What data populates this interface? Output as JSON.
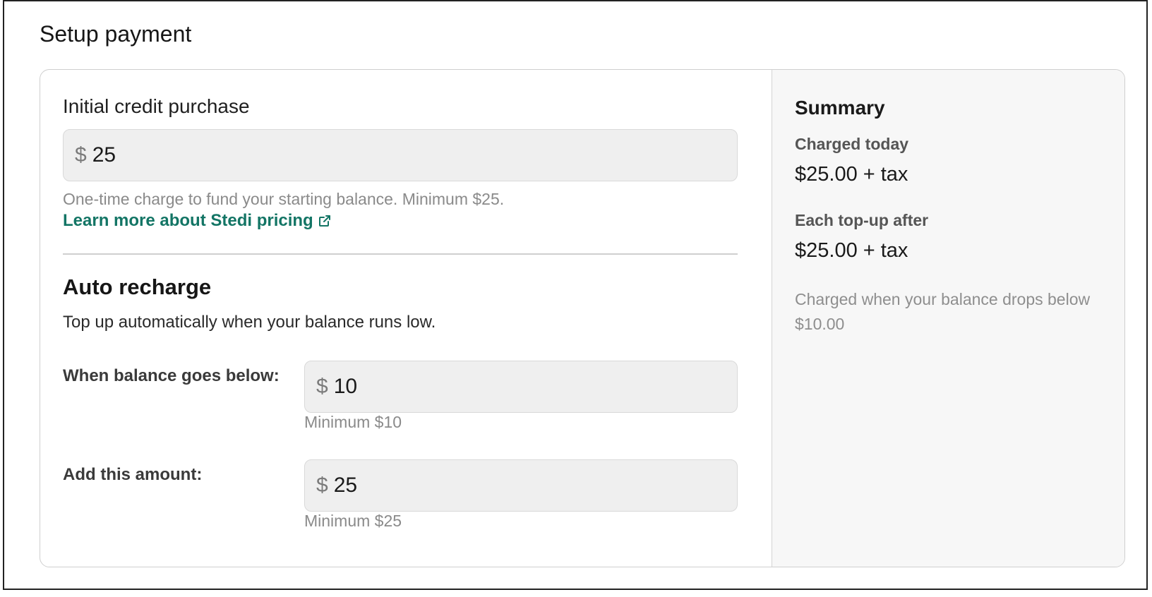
{
  "page": {
    "title": "Setup payment"
  },
  "initial_purchase": {
    "label": "Initial credit purchase",
    "currency_symbol": "$",
    "value": "25",
    "help": "One-time charge to fund your starting balance. Minimum $25.",
    "link_label": "Learn more about Stedi pricing",
    "link_icon": "external-link-icon"
  },
  "auto_recharge": {
    "title": "Auto recharge",
    "description": "Top up automatically when your balance runs low.",
    "threshold": {
      "label": "When balance goes below:",
      "currency_symbol": "$",
      "value": "10",
      "help": "Minimum $10"
    },
    "amount": {
      "label": "Add this amount:",
      "currency_symbol": "$",
      "value": "25",
      "help": "Minimum $25"
    }
  },
  "summary": {
    "title": "Summary",
    "charged_today_label": "Charged today",
    "charged_today_value": "$25.00 + tax",
    "topup_label": "Each top-up after",
    "topup_value": "$25.00 + tax",
    "note": "Charged when your balance drops below $10.00"
  },
  "colors": {
    "link": "#137565",
    "input_bg": "#efefef",
    "summary_bg": "#f7f7f7"
  }
}
